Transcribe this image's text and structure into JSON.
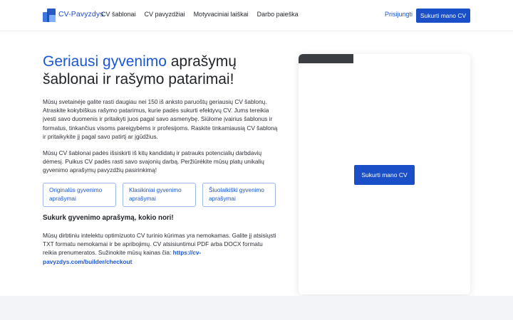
{
  "header": {
    "brand": "CV-Pavyzdys",
    "nav": [
      "CV šablonai",
      "CV pavyzdžiai",
      "Motyvaciniai laiškai",
      "Darbo paieška"
    ],
    "login_label": "Prisijungti",
    "cta_label": "Sukurti mano CV"
  },
  "hero": {
    "headline_accent": "Geriausi gyvenimo",
    "headline_rest": " aprašymų šablonai ir rašymo patarimai!",
    "paragraph1": "Mūsų svetainėje galite rasti daugiau nei 150 iš anksto paruoštų geriausių CV šablonų. Atraskite kokybiškus rašymo patarimus, kurie padės sukurti efektyvų CV. Jums tereikia įvesti savo duomenis ir pritaikyti juos pagal savo asmenybę. Siūlome įvairius šablonus ir formatus, tinkančius visoms pareigybėms ir profesijoms. Raskite tinkamiausią CV šabloną ir pritaikykite jį pagal savo patirtį ar įgūdžius.",
    "paragraph2": "Mūsų CV šablonai padės išsiskirti iš kitų kandidatų ir patrauks potencialių darbdavių dėmesį. Puikus CV padės rasti savo svajonių darbą. Peržiūrėkite mūsų platų unikalių gyvenimo aprašymų pavyzdžių pasirinkimą!",
    "cards": [
      "Originalūs gyvenimo aprašymai",
      "Klasikiniai gyvenimo aprašymai",
      "Šiuolaikiški gyvenimo aprašymai"
    ],
    "subheading": "Sukurk gyvenimo aprašymą, kokio nori!",
    "paragraph3": "Mūsų dirbtiniu intelektu optimizuoto CV turinio kūrimas yra nemokamas. Galite jį atsisiųsti TXT formatu nemokamai ir be apribojimų. CV atsisiuntimui PDF arba DOCX formatu reikia prenumeratos. Sužinokite mūsų kainas čia: ",
    "pricing_link": "https://cv-pavyzdys.com/builder/checkout"
  },
  "panel": {
    "cta_label": "Sukurti mano CV"
  },
  "colors": {
    "accent": "#1a56d6",
    "button": "#1a4fc8"
  }
}
